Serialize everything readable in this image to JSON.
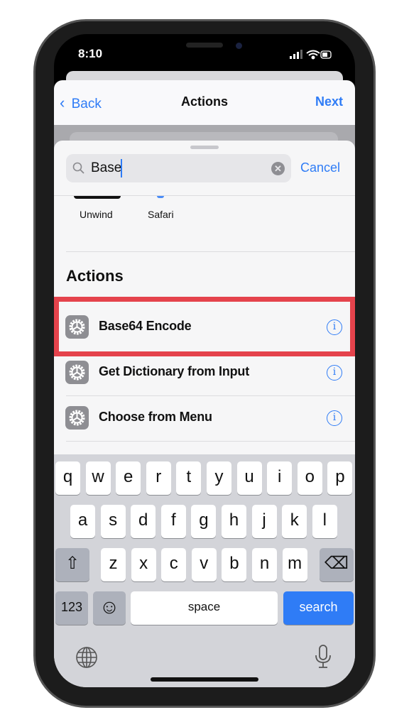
{
  "status": {
    "time": "8:10"
  },
  "nav": {
    "back": "Back",
    "title": "Actions",
    "next": "Next"
  },
  "search": {
    "value": "Base",
    "cancel": "Cancel"
  },
  "apps": [
    {
      "label": "Unwind"
    },
    {
      "label": "Safari"
    }
  ],
  "section_title": "Actions",
  "actions": [
    {
      "label": "Base64 Encode",
      "highlighted": true
    },
    {
      "label": "Get Dictionary from Input"
    },
    {
      "label": "Choose from Menu"
    }
  ],
  "highlight_color": "#e5434c",
  "accent_color": "#2f7cf6",
  "keyboard": {
    "row1": [
      "q",
      "w",
      "e",
      "r",
      "t",
      "y",
      "u",
      "i",
      "o",
      "p"
    ],
    "row2": [
      "a",
      "s",
      "d",
      "f",
      "g",
      "h",
      "j",
      "k",
      "l"
    ],
    "row3": [
      "z",
      "x",
      "c",
      "v",
      "b",
      "n",
      "m"
    ],
    "numbers": "123",
    "space": "space",
    "search": "search"
  }
}
